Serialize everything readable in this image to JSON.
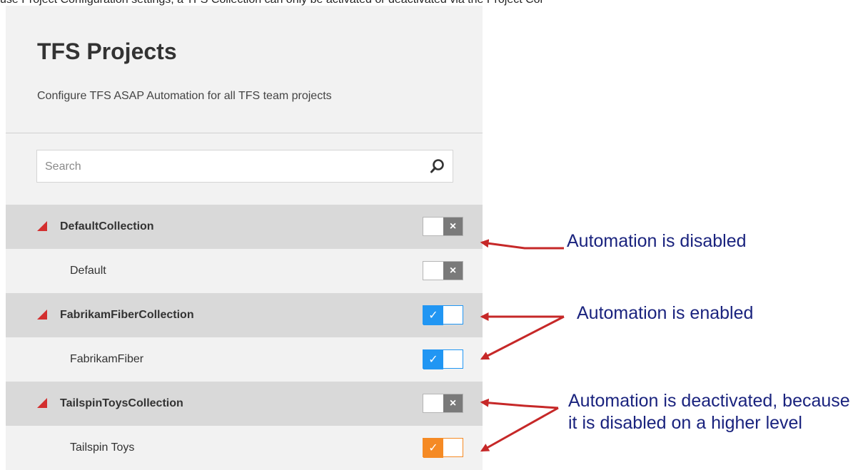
{
  "top_text": "use Project Configuration settings, a TFS Collection can only be activated or deactivated via the Project Configuration settings.",
  "panel": {
    "title": "TFS Projects",
    "subtitle": "Configure TFS ASAP Automation for all TFS team projects",
    "search": {
      "placeholder": "Search",
      "icon": "search-icon"
    }
  },
  "rows": [
    {
      "type": "collection",
      "label": "DefaultCollection",
      "state": "disabled"
    },
    {
      "type": "project",
      "label": "Default",
      "state": "disabled"
    },
    {
      "type": "collection",
      "label": "FabrikamFiberCollection",
      "state": "enabled"
    },
    {
      "type": "project",
      "label": "FabrikamFiber",
      "state": "enabled"
    },
    {
      "type": "collection",
      "label": "TailspinToysCollection",
      "state": "disabled"
    },
    {
      "type": "project",
      "label": "Tailspin Toys",
      "state": "deactivated"
    }
  ],
  "toggle_symbols": {
    "off": "×",
    "on": "✓"
  },
  "colors": {
    "enabled": "#2196f3",
    "deactivated": "#f58a24",
    "off_mark": "#7a7a7a",
    "triangle": "#d32f2f",
    "arrow": "#c62828",
    "annotation_text": "#1a237e"
  },
  "annotations": [
    {
      "text": "Automation is disabled"
    },
    {
      "text": "Automation is enabled"
    },
    {
      "text": "Automation is deactivated, because it is disabled on a higher level"
    }
  ]
}
